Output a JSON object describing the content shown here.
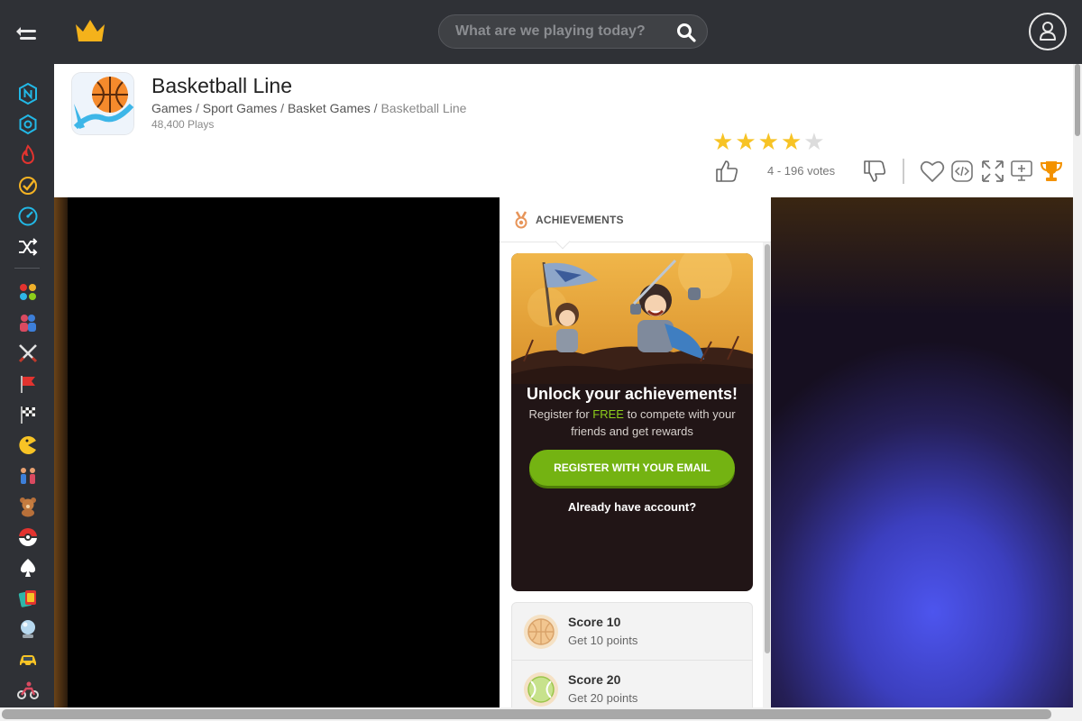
{
  "topbar": {
    "search_placeholder": "What are we playing today?"
  },
  "sidebar": {
    "items": [
      {
        "icon": "new-icon",
        "color": "#22b8e6"
      },
      {
        "icon": "atom-icon",
        "color": "#22b8e6"
      },
      {
        "icon": "fire-icon",
        "color": "#e2332f"
      },
      {
        "icon": "check-circle-icon",
        "color": "#f5b323"
      },
      {
        "icon": "speedometer-icon",
        "color": "#22b8e6"
      },
      {
        "icon": "shuffle-icon",
        "color": "#ffffff"
      },
      {
        "icon": "dots-grid-icon",
        "color": "#f0b02b"
      },
      {
        "icon": "two-players-icon",
        "color": "#d94a60"
      },
      {
        "icon": "crossed-swords-icon",
        "color": "#e2e2e2"
      },
      {
        "icon": "flag-icon",
        "color": "#e2332f"
      },
      {
        "icon": "racing-flag-icon",
        "color": "#ffffff"
      },
      {
        "icon": "pacman-icon",
        "color": "#f7c325"
      },
      {
        "icon": "people-icon",
        "color": "#e8a070"
      },
      {
        "icon": "teddy-bear-icon",
        "color": "#b8703a"
      },
      {
        "icon": "pokeball-icon",
        "color": "#e2332f"
      },
      {
        "icon": "spade-icon",
        "color": "#ffffff"
      },
      {
        "icon": "cards-icon",
        "color": "#2fb5a8"
      },
      {
        "icon": "crystal-ball-icon",
        "color": "#b7d8ef"
      },
      {
        "icon": "car-icon",
        "color": "#f7c325"
      },
      {
        "icon": "motorbike-icon",
        "color": "#d94a60"
      }
    ]
  },
  "game": {
    "title": "Basketball Line",
    "breadcrumbs": [
      "Games",
      "Sport Games",
      "Basket Games",
      "Basketball Line"
    ],
    "plays": "48,400 Plays",
    "rating": 4,
    "rating_max": 5,
    "votes": "4 - 196 votes"
  },
  "achievements": {
    "header": "ACHIEVEMENTS",
    "promo_title": "Unlock your achievements!",
    "promo_text_before": "Register for",
    "promo_text_free": "FREE",
    "promo_text_after": "to compete with your friends and get rewards",
    "register_button": "REGISTER WITH YOUR EMAIL",
    "login_link": "Already have account?",
    "items": [
      {
        "name": "Score 10",
        "desc": "Get 10 points",
        "icon": "basketball-icon"
      },
      {
        "name": "Score 20",
        "desc": "Get 20 points",
        "icon": "tennis-ball-icon"
      }
    ]
  },
  "colors": {
    "brand_crown": "#f4b21b",
    "star": "#f7c325",
    "trophy": "#f39200",
    "register_green": "#74b312"
  }
}
